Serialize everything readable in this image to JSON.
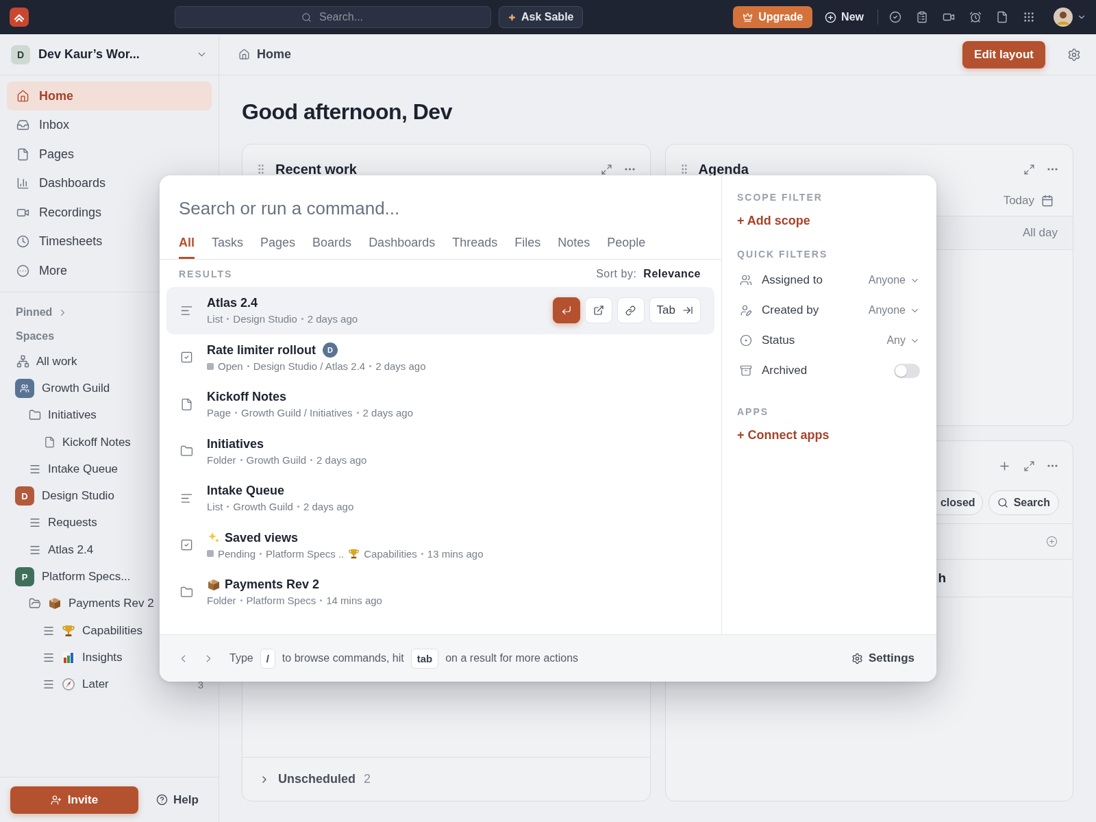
{
  "top_bar": {
    "search": {
      "placeholder": "Search..."
    },
    "assistant_button": "Ask Sable",
    "upgrade_button": "Upgrade",
    "new_button": "New"
  },
  "sidebar": {
    "workspace": {
      "initial": "D",
      "name": "Dev Kaur’s Wor..."
    },
    "nav": [
      {
        "label": "Home",
        "selected": true
      },
      {
        "label": "Inbox",
        "selected": false
      },
      {
        "label": "Pages",
        "selected": false
      },
      {
        "label": "Dashboards",
        "selected": false
      },
      {
        "label": "Recordings",
        "selected": false
      },
      {
        "label": "Timesheets",
        "selected": false
      },
      {
        "label": "More",
        "selected": false
      }
    ],
    "pinned": "Pinned",
    "spaces_heading": "Spaces",
    "tree": [
      {
        "kind": "network",
        "label": "All work"
      },
      {
        "kind": "space",
        "label": "Growth Guild",
        "color": "#587393",
        "children": [
          {
            "kind": "folder",
            "label": "Initiatives",
            "children": [
              {
                "kind": "page",
                "label": "Kickoff Notes"
              }
            ]
          },
          {
            "kind": "list",
            "label": "Intake Queue"
          }
        ]
      },
      {
        "kind": "space",
        "label": "Design Studio",
        "initial": "D",
        "color": "#b25a3b",
        "children": [
          {
            "kind": "list",
            "label": "Requests"
          },
          {
            "kind": "list",
            "label": "Atlas 2.4"
          }
        ]
      },
      {
        "kind": "space",
        "label": "Platform Specs...",
        "initial": "P",
        "color": "#3f6f5b",
        "children": [
          {
            "kind": "folder-open",
            "label": "Payments Rev 2",
            "children": [
              {
                "kind": "list",
                "label": "Capabilities"
              },
              {
                "kind": "list",
                "label": "Insights"
              },
              {
                "kind": "list",
                "label": "Later",
                "count": "3"
              }
            ]
          }
        ]
      }
    ],
    "invite_button": "Invite",
    "help_link": "Help"
  },
  "main": {
    "breadcrumb": "Home",
    "edit_layout_button": "Edit layout",
    "greeting": "Good afternoon, Dev",
    "recent_work": {
      "title": "Recent work",
      "footer": {
        "label": "Unscheduled",
        "count": "2"
      }
    },
    "agenda": {
      "title": "Agenda",
      "date_button": "Today",
      "all_day": "All day"
    },
    "card_3": {
      "chips": [
        {
          "kind": "plain",
          "label": "closed"
        },
        {
          "kind": "search",
          "label": "Search"
        }
      ],
      "row_text": "h"
    }
  },
  "modal": {
    "search": {
      "placeholder": "Search or run a command..."
    },
    "tabs": [
      {
        "label": "All",
        "selected": true
      },
      {
        "label": "Tasks",
        "selected": false
      },
      {
        "label": "Pages",
        "selected": false
      },
      {
        "label": "Boards",
        "selected": false
      },
      {
        "label": "Dashboards",
        "selected": false
      },
      {
        "label": "Threads",
        "selected": false
      },
      {
        "label": "Files",
        "selected": false
      },
      {
        "label": "Notes",
        "selected": false
      },
      {
        "label": "People",
        "selected": false
      }
    ],
    "results_heading": "RESULTS",
    "sort_label": "Sort by:",
    "sort_value": "Relevance",
    "tab_action": "Tab",
    "results": [
      {
        "kind": "list",
        "title": "Atlas 2.4",
        "meta": [
          "List",
          "Design Studio",
          "2 days ago"
        ],
        "selected": true
      },
      {
        "kind": "task",
        "title": "Rate limiter rollout",
        "assignee": "D",
        "status": "Open",
        "meta": [
          "Design Studio / Atlas 2.4",
          "2 days ago"
        ],
        "selected": false
      },
      {
        "kind": "page",
        "title": "Kickoff Notes",
        "meta": [
          "Page",
          "Growth Guild / Initiatives",
          "2 days ago"
        ],
        "selected": false
      },
      {
        "kind": "folder",
        "title": "Initiatives",
        "meta": [
          "Folder",
          "Growth Guild",
          "2 days ago"
        ],
        "selected": false
      },
      {
        "kind": "list",
        "title": "Intake Queue",
        "meta": [
          "List",
          "Growth Guild",
          "2 days ago"
        ],
        "selected": false
      },
      {
        "kind": "task",
        "title": "Saved views",
        "status": "Pending",
        "meta": [
          "Platform Specs ..",
          "Capabilities",
          "13 mins ago"
        ],
        "selected": false
      },
      {
        "kind": "folder",
        "title": "Payments Rev 2",
        "meta": [
          "Folder",
          "Platform Specs",
          "14 mins ago"
        ],
        "selected": false
      }
    ],
    "scope_heading": "SCOPE FILTER",
    "add_scope": "+ Add scope",
    "quick_heading": "QUICK FILTERS",
    "filters": [
      {
        "kind": "select",
        "label": "Assigned to",
        "value": "Anyone"
      },
      {
        "kind": "select",
        "label": "Created by",
        "value": "Anyone"
      },
      {
        "kind": "select",
        "label": "Status",
        "value": "Any"
      },
      {
        "kind": "toggle",
        "label": "Archived",
        "on": false
      }
    ],
    "apps_heading": "APPS",
    "connect_apps": "+ Connect apps",
    "footer": {
      "before": "Type",
      "key_1": "/",
      "middle": "to browse commands, hit",
      "key_2": "tab",
      "after": "on a result for more actions",
      "settings": "Settings"
    }
  }
}
